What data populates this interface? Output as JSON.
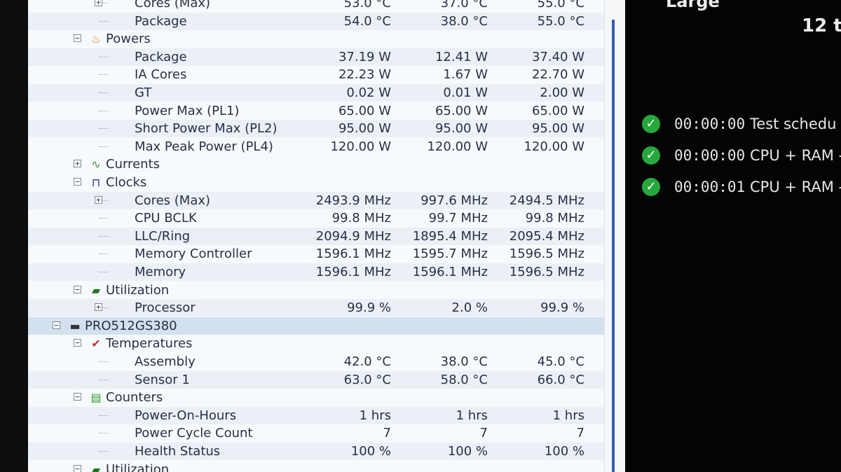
{
  "tree": [
    {
      "label": "Cores (Max)",
      "v1": "53.0 °C",
      "v2": "37.0 °C",
      "v3": "55.0 °C",
      "level": 2,
      "expander": "+",
      "partial": true
    },
    {
      "label": "Package",
      "v1": "54.0 °C",
      "v2": "38.0 °C",
      "v3": "55.0 °C",
      "level": 2
    },
    {
      "label": "Powers",
      "level": 1,
      "expander": "-",
      "icon": "power-icon"
    },
    {
      "label": "Package",
      "v1": "37.19 W",
      "v2": "12.41 W",
      "v3": "37.40 W",
      "level": 2
    },
    {
      "label": "IA Cores",
      "v1": "22.23 W",
      "v2": "1.67 W",
      "v3": "22.70 W",
      "level": 2
    },
    {
      "label": "GT",
      "v1": "0.02 W",
      "v2": "0.01 W",
      "v3": "2.00 W",
      "level": 2
    },
    {
      "label": "Power Max (PL1)",
      "v1": "65.00 W",
      "v2": "65.00 W",
      "v3": "65.00 W",
      "level": 2
    },
    {
      "label": "Short Power Max (PL2)",
      "v1": "95.00 W",
      "v2": "95.00 W",
      "v3": "95.00 W",
      "level": 2
    },
    {
      "label": "Max Peak Power (PL4)",
      "v1": "120.00 W",
      "v2": "120.00 W",
      "v3": "120.00 W",
      "level": 2
    },
    {
      "label": "Currents",
      "level": 1,
      "expander": "+",
      "icon": "currents-icon"
    },
    {
      "label": "Clocks",
      "level": 1,
      "expander": "-",
      "icon": "clocks-icon"
    },
    {
      "label": "Cores (Max)",
      "v1": "2493.9 MHz",
      "v2": "997.6 MHz",
      "v3": "2494.5 MHz",
      "level": 2,
      "expander": "+"
    },
    {
      "label": "CPU BCLK",
      "v1": "99.8 MHz",
      "v2": "99.7 MHz",
      "v3": "99.8 MHz",
      "level": 2
    },
    {
      "label": "LLC/Ring",
      "v1": "2094.9 MHz",
      "v2": "1895.4 MHz",
      "v3": "2095.4 MHz",
      "level": 2
    },
    {
      "label": "Memory Controller",
      "v1": "1596.1 MHz",
      "v2": "1595.7 MHz",
      "v3": "1596.5 MHz",
      "level": 2
    },
    {
      "label": "Memory",
      "v1": "1596.1 MHz",
      "v2": "1596.1 MHz",
      "v3": "1596.5 MHz",
      "level": 2
    },
    {
      "label": "Utilization",
      "level": 1,
      "expander": "-",
      "icon": "utilization-icon"
    },
    {
      "label": "Processor",
      "v1": "99.9 %",
      "v2": "2.0 %",
      "v3": "99.9 %",
      "level": 2,
      "expander": "+"
    },
    {
      "label": "PRO512GS380",
      "level": 0,
      "expander": "-",
      "icon": "drive-icon",
      "selected": true
    },
    {
      "label": "Temperatures",
      "level": 1,
      "expander": "-",
      "icon": "thermometer-icon"
    },
    {
      "label": "Assembly",
      "v1": "42.0 °C",
      "v2": "38.0 °C",
      "v3": "45.0 °C",
      "level": 2
    },
    {
      "label": "Sensor 1",
      "v1": "63.0 °C",
      "v2": "58.0 °C",
      "v3": "66.0 °C",
      "level": 2
    },
    {
      "label": "Counters",
      "level": 1,
      "expander": "-",
      "icon": "counters-icon"
    },
    {
      "label": "Power-On-Hours",
      "v1": "1 hrs",
      "v2": "1 hrs",
      "v3": "1 hrs",
      "level": 2
    },
    {
      "label": "Power Cycle Count",
      "v1": "7",
      "v2": "7",
      "v3": "7",
      "level": 2
    },
    {
      "label": "Health Status",
      "v1": "100 %",
      "v2": "100 %",
      "v3": "100 %",
      "level": 2
    },
    {
      "label": "Utilization",
      "level": 1,
      "expander": "-",
      "icon": "utilization-icon"
    }
  ],
  "right_panel": {
    "top_label": "Large",
    "counter": "12 t",
    "statuses": [
      {
        "time": "00:00:00",
        "text": "Test schedu",
        "icon": "check-icon"
      },
      {
        "time": "00:00:00",
        "text": "CPU + RAM -",
        "icon": "check-icon"
      },
      {
        "time": "00:00:01",
        "text": "CPU + RAM -",
        "icon": "check-icon"
      }
    ]
  },
  "colors": {
    "panel_bg": "#f7fafd",
    "row_alt": "#eaf0f6",
    "selected_row": "#d3e1ee",
    "text": "#2a2f45",
    "check": "#26a83c",
    "scroll_accent": "#2f5fae"
  }
}
